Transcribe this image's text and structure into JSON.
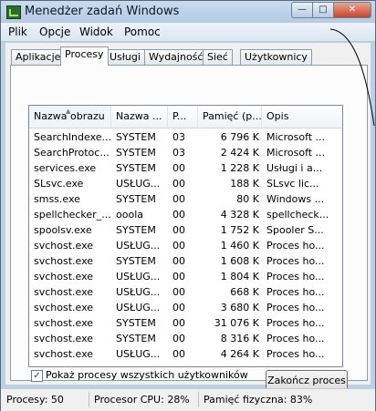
{
  "window": {
    "title": "Menedżer zadań Windows",
    "minimize_glyph": "—",
    "maximize_glyph": "□",
    "close_glyph": "✕"
  },
  "menu": [
    "Plik",
    "Opcje",
    "Widok",
    "Pomoc"
  ],
  "tabs": [
    {
      "label": "Aplikacje"
    },
    {
      "label": "Procesy",
      "active": true
    },
    {
      "label": "Usługi"
    },
    {
      "label": "Wydajność"
    },
    {
      "label": "Sieć"
    },
    {
      "label": "Użytkownicy"
    }
  ],
  "list": {
    "columns": [
      "Nazwa obrazu",
      "Nazwa ...",
      "P...",
      "Pamięć (p...",
      "Opis"
    ],
    "sorted_column": "Nazwa obrazu",
    "rows": [
      [
        "SearchIndexe...",
        "SYSTEM",
        "03",
        "6 796 K",
        "Microsoft ..."
      ],
      [
        "SearchProtoc...",
        "SYSTEM",
        "03",
        "2 424 K",
        "Microsoft ..."
      ],
      [
        "services.exe",
        "SYSTEM",
        "00",
        "1 228 K",
        "Usługi i a..."
      ],
      [
        "SLsvc.exe",
        "USŁUG...",
        "00",
        "188 K",
        "SLsvc lic..."
      ],
      [
        "smss.exe",
        "SYSTEM",
        "00",
        "80 K",
        "Windows ..."
      ],
      [
        "spellchecker_...",
        "ooola",
        "00",
        "4 328 K",
        "spellcheck..."
      ],
      [
        "spoolsv.exe",
        "SYSTEM",
        "00",
        "1 752 K",
        "Spooler S..."
      ],
      [
        "svchost.exe",
        "USŁUG...",
        "00",
        "1 460 K",
        "Proces ho..."
      ],
      [
        "svchost.exe",
        "SYSTEM",
        "00",
        "1 608 K",
        "Proces ho..."
      ],
      [
        "svchost.exe",
        "USŁUG...",
        "00",
        "1 804 K",
        "Proces ho..."
      ],
      [
        "svchost.exe",
        "USŁUG...",
        "00",
        "668 K",
        "Proces ho..."
      ],
      [
        "svchost.exe",
        "USŁUG...",
        "00",
        "3 680 K",
        "Proces ho..."
      ],
      [
        "svchost.exe",
        "SYSTEM",
        "00",
        "31 076 K",
        "Proces ho..."
      ],
      [
        "svchost.exe",
        "SYSTEM",
        "00",
        "8 316 K",
        "Proces ho..."
      ],
      [
        "svchost.exe",
        "USŁUG...",
        "00",
        "4 264 K",
        "Proces ho..."
      ]
    ],
    "scroll_position": 0.55
  },
  "controls": {
    "show_all_users_label": "Pokaż procesy wszystkich użytkowników",
    "show_all_users_checked": true,
    "end_process_label": "Zakończ proces"
  },
  "status": {
    "processes": "Procesy: 50",
    "cpu": "Procesor CPU: 28%",
    "memory": "Pamięć fizyczna: 83%"
  }
}
